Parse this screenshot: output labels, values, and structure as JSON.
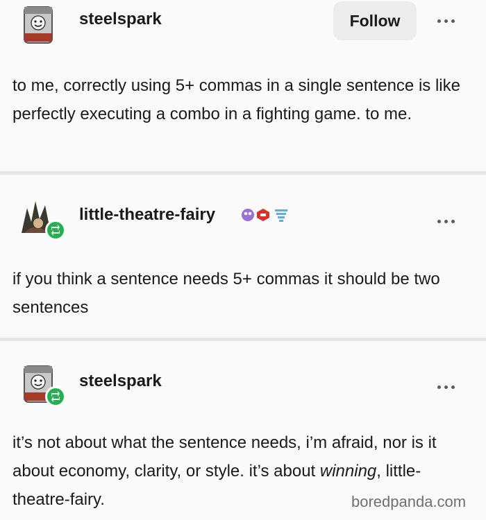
{
  "posts": [
    {
      "username": "steelspark",
      "follow_label": "Follow",
      "text": "to me, correctly using 5+ commas in a single sentence is like perfectly executing a combo in a fighting game. to me."
    },
    {
      "username": "little-theatre-fairy",
      "badges": [
        "purple-bubble-badge",
        "red-gem-badge",
        "blue-fish-badge"
      ],
      "text": "if you think a sentence needs 5+ commas it should be two sentences"
    },
    {
      "username": "steelspark",
      "text_before": "it’s not about what the sentence needs, i’m afraid, nor is it about economy, clarity, or style. it’s about ",
      "text_emphasis": "winning",
      "text_after": ", little-theatre-fairy."
    }
  ],
  "watermark": "boredpanda.com",
  "colors": {
    "background": "#fafafa",
    "divider": "#e6e6e6",
    "reblog_badge": "#22b14c",
    "follow_button_bg": "#ececec",
    "text": "#1a1a1a",
    "watermark": "#6f6f6f"
  }
}
